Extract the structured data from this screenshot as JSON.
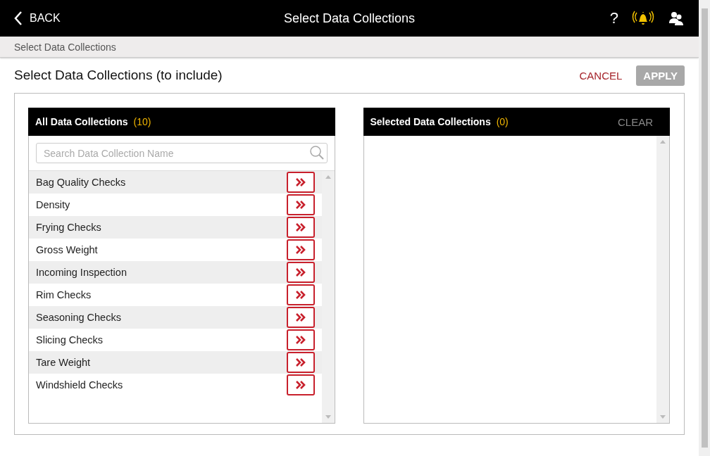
{
  "header": {
    "back_label": "BACK",
    "title": "Select Data Collections",
    "help": "?"
  },
  "breadcrumb": "Select Data Collections",
  "page_title": "Select Data Collections (to include)",
  "actions": [
    {
      "label": "CANCEL",
      "kind": "link",
      "disabled": false
    },
    {
      "label": "APPLY",
      "kind": "button",
      "disabled": true
    }
  ],
  "all_panel": {
    "title": "All Data Collections",
    "count": "(10)",
    "search": {
      "placeholder": "Search Data Collection Name"
    },
    "items": [
      "Bag Quality Checks",
      "Density",
      "Frying Checks",
      "Gross Weight",
      "Incoming Inspection",
      "Rim Checks",
      "Seasoning Checks",
      "Slicing Checks",
      "Tare Weight",
      "Windshield Checks"
    ]
  },
  "selected_panel": {
    "title": "Selected Data Collections",
    "count": "(0)",
    "clear": {
      "label": "CLEAR",
      "disabled": true
    }
  }
}
